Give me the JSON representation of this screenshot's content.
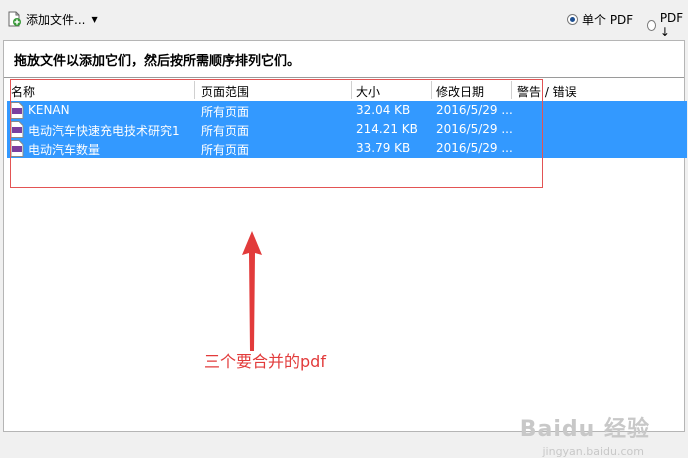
{
  "toolbar": {
    "add_files_label": "添加文件...",
    "output_options": [
      {
        "label": "单个 PDF",
        "checked": true
      },
      {
        "label": "PDF ↓",
        "checked": false
      }
    ]
  },
  "instruction": "拖放文件以添加它们，然后按所需顺序排列它们。",
  "table": {
    "columns": [
      "名称",
      "页面范围",
      "大小",
      "修改日期",
      "警告 / 错误"
    ],
    "rows": [
      {
        "name": "KENAN",
        "page_range": "所有页面",
        "size": "32.04 KB",
        "modified": "2016/5/29 ...",
        "warning": ""
      },
      {
        "name": "电动汽车快速充电技术研究1",
        "page_range": "所有页面",
        "size": "214.21 KB",
        "modified": "2016/5/29 ...",
        "warning": ""
      },
      {
        "name": "电动汽车数量",
        "page_range": "所有页面",
        "size": "33.79 KB",
        "modified": "2016/5/29 ...",
        "warning": ""
      }
    ]
  },
  "annotation": "三个要合并的pdf",
  "watermark": {
    "text": "Baidu 经验",
    "sub": "jingyan.baidu.com"
  },
  "colors": {
    "selection": "#3399ff",
    "annotation": "#e23b3b"
  }
}
